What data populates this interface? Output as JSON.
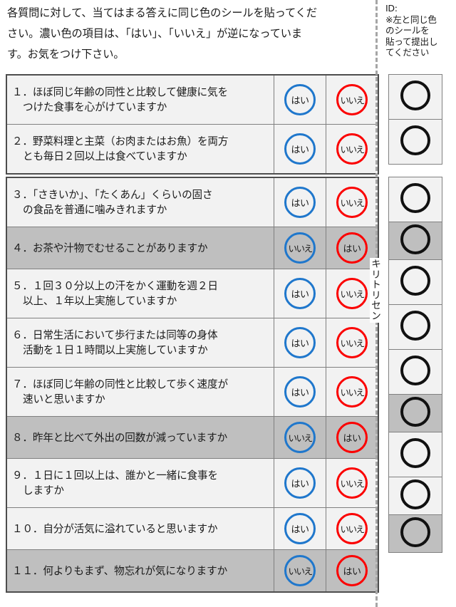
{
  "intro": {
    "line1": "各質問に対して、当てはまる答えに同じ色のシールを貼ってくだ",
    "line2": "さい。濃い色の項目は、「はい」、「いいえ」が逆になっていま",
    "line3": "す。お気をつけ下さい。"
  },
  "cut_line": {
    "chars": [
      "キ",
      "リ",
      "ト",
      "リ",
      "セ",
      "ン"
    ]
  },
  "id_panel": {
    "label": "ID:",
    "note_line1": "※左と同じ色",
    "note_line2": "のシールを",
    "note_line3": "貼って提出し",
    "note_line4": "てください"
  },
  "answers": {
    "yes": "はい",
    "no": "いいえ"
  },
  "colors": {
    "blue": "#1f77cc",
    "red": "#fb0000",
    "row_normal": "#f2f2f2",
    "row_shaded": "#bfbfbf",
    "border": "#808080",
    "sticker_ring": "#111111"
  },
  "groups": [
    {
      "id": "group-a",
      "questions": [
        {
          "number": "1",
          "line1": "１．ほぼ同じ年齢の同性と比較して健康に気を",
          "line2": "つけた食事を心がけていますか",
          "shaded": false,
          "left_answer": "はい",
          "right_answer": "いいえ"
        },
        {
          "number": "2",
          "line1": "２．野菜料理と主菜（お肉またはお魚）を両方",
          "line2": "とも毎日２回以上は食べていますか",
          "shaded": false,
          "left_answer": "はい",
          "right_answer": "いいえ"
        }
      ]
    },
    {
      "id": "group-b",
      "questions": [
        {
          "number": "3",
          "line1": "３．「さきいか」、「たくあん」くらいの固さ",
          "line2": "の食品を普通に噛みきれますか",
          "shaded": false,
          "left_answer": "はい",
          "right_answer": "いいえ"
        },
        {
          "number": "4",
          "line1": "４．お茶や汁物でむせることがありますか",
          "line2": "",
          "shaded": true,
          "left_answer": "いいえ",
          "right_answer": "はい"
        },
        {
          "number": "5",
          "line1": "５．１回３０分以上の汗をかく運動を週２日",
          "line2": "以上、１年以上実施していますか",
          "shaded": false,
          "left_answer": "はい",
          "right_answer": "いいえ"
        },
        {
          "number": "6",
          "line1": "６．日常生活において歩行または同等の身体",
          "line2": "活動を１日１時間以上実施していますか",
          "shaded": false,
          "left_answer": "はい",
          "right_answer": "いいえ"
        },
        {
          "number": "7",
          "line1": "７．ほぼ同じ年齢の同性と比較して歩く速度が",
          "line2": "速いと思いますか",
          "shaded": false,
          "left_answer": "はい",
          "right_answer": "いいえ"
        },
        {
          "number": "8",
          "line1": "８．昨年と比べて外出の回数が減っていますか",
          "line2": "",
          "shaded": true,
          "left_answer": "いいえ",
          "right_answer": "はい"
        },
        {
          "number": "9",
          "line1": "９．１日に１回以上は、誰かと一緒に食事を",
          "line2": "しますか",
          "shaded": false,
          "left_answer": "はい",
          "right_answer": "いいえ"
        },
        {
          "number": "10",
          "line1": "１０．自分が活気に溢れていると思いますか",
          "line2": "",
          "shaded": false,
          "left_answer": "はい",
          "right_answer": "いいえ"
        },
        {
          "number": "11",
          "line1": "１１．何よりもまず、物忘れが気になりますか",
          "line2": "",
          "shaded": true,
          "left_answer": "いいえ",
          "right_answer": "はい"
        }
      ]
    }
  ]
}
